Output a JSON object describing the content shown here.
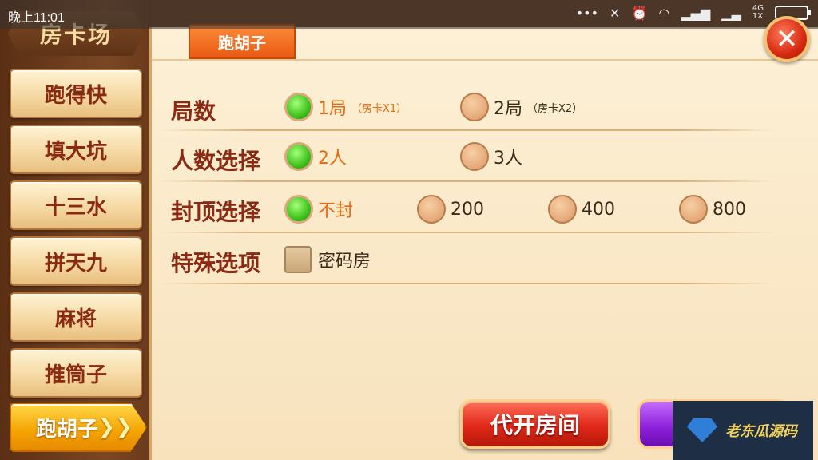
{
  "status_bar": {
    "time": "晚上11:01",
    "icons": [
      "more-dots-icon",
      "silent-icon",
      "alarm-icon",
      "wifi-icon",
      "signal-icon",
      "signal-bars-icon",
      "network-4g-icon",
      "battery-icon"
    ]
  },
  "sidebar": {
    "title": "房卡场",
    "items": [
      {
        "label": "跑得快"
      },
      {
        "label": "填大坑"
      },
      {
        "label": "十三水"
      },
      {
        "label": "拼天九"
      },
      {
        "label": "麻将"
      },
      {
        "label": "推筒子"
      },
      {
        "label": "跑胡子",
        "active": true
      }
    ]
  },
  "tab": {
    "label": "跑胡子"
  },
  "settings": {
    "rounds": {
      "label": "局数",
      "options": [
        {
          "text": "1局",
          "sub": "（房卡X1）",
          "selected": true
        },
        {
          "text": "2局",
          "sub": "（房卡X2）",
          "selected": false
        }
      ]
    },
    "players": {
      "label": "人数选择",
      "options": [
        {
          "text": "2人",
          "selected": true
        },
        {
          "text": "3人",
          "selected": false
        }
      ]
    },
    "cap": {
      "label": "封顶选择",
      "options": [
        {
          "text": "不封",
          "selected": true
        },
        {
          "text": "200",
          "selected": false
        },
        {
          "text": "400",
          "selected": false
        },
        {
          "text": "800",
          "selected": false
        }
      ]
    },
    "special": {
      "label": "特殊选项",
      "options": [
        {
          "text": "密码房",
          "checked": false
        }
      ]
    }
  },
  "buttons": {
    "open_room": "代开房间"
  },
  "watermark": {
    "text": "老东瓜源码"
  },
  "colors": {
    "accent_orange": "#e85a12",
    "selected_green": "#3fc21c",
    "label_red": "#8a2a12",
    "active_tab_yellow": "#f5a300"
  }
}
